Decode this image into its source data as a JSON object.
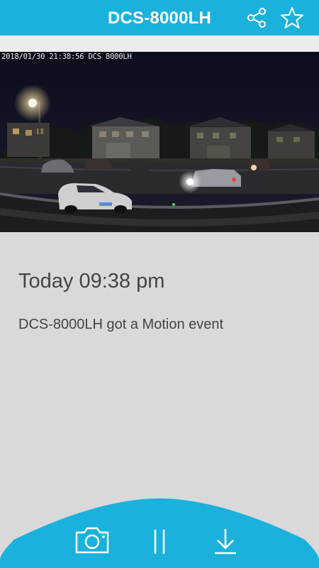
{
  "header": {
    "title": "DCS-8000LH",
    "share_icon": "share-icon",
    "star_icon": "star-icon",
    "accent_color": "#1ab2dc"
  },
  "video": {
    "timestamp_overlay": "2018/01/30 21:38:56 DCS 8000LH"
  },
  "event": {
    "time": "Today 09:38 pm",
    "description": "DCS-8000LH got a Motion event"
  },
  "toolbar": {
    "snapshot_icon": "camera-icon",
    "pause_icon": "pause-icon",
    "download_icon": "download-icon"
  }
}
